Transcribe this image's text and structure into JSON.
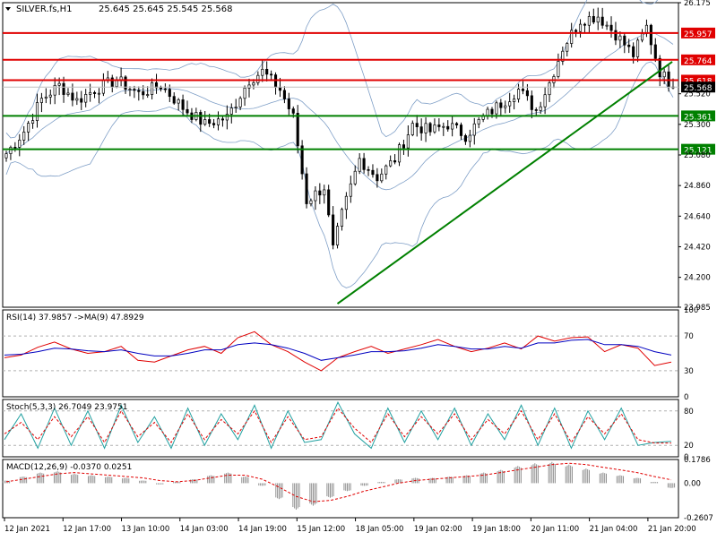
{
  "header": {
    "symbol": "SILVER.fs,H1",
    "ohlc": "25.645 25.645 25.545 25.568"
  },
  "colors": {
    "background": "#ffffff",
    "resistance": "#e00000",
    "support": "#008000",
    "trendline": "#008000",
    "candle": "#000000",
    "bollinger": "#7f9fc7",
    "rsi": "#e00000",
    "rsi_ma": "#0000c0",
    "stoch_main": "#20a0a0",
    "stoch_signal": "#e00000",
    "macd_hist": "#909090",
    "macd_signal": "#e00000",
    "grid_level": "#b0b0b0"
  },
  "chart_data": [
    {
      "type": "candlestick",
      "panel": "price",
      "ylim": [
        23.985,
        26.175
      ],
      "y_ticks": [
        "26.175",
        "25.957",
        "25.764",
        "25.618",
        "25.568",
        "25.520",
        "25.361",
        "25.300",
        "25.121",
        "25.080",
        "24.860",
        "24.640",
        "24.420",
        "24.200",
        "23.985"
      ],
      "x_labels": [
        "12 Jan 2021",
        "12 Jan 17:00",
        "13 Jan 10:00",
        "14 Jan 03:00",
        "14 Jan 19:00",
        "15 Jan 12:00",
        "18 Jan 05:00",
        "19 Jan 02:00",
        "19 Jan 18:00",
        "20 Jan 11:00",
        "21 Jan 04:00",
        "21 Jan 20:00"
      ],
      "levels": [
        {
          "value": 25.957,
          "label": "25.957",
          "kind": "resistance"
        },
        {
          "value": 25.764,
          "label": "25.764",
          "kind": "resistance"
        },
        {
          "value": 25.618,
          "label": "25.618",
          "kind": "resistance"
        },
        {
          "value": 25.361,
          "label": "25.361",
          "kind": "support"
        },
        {
          "value": 25.121,
          "label": "25.121",
          "kind": "support"
        }
      ],
      "current_price": {
        "value": 25.568,
        "label": "25.568"
      },
      "trendline": {
        "from": {
          "bar": 75,
          "value": 24.01
        },
        "to": {
          "bar": 150,
          "value": 25.75
        }
      },
      "close_path": [
        {
          "bar": 0,
          "value": 25.09
        },
        {
          "bar": 4,
          "value": 25.25
        },
        {
          "bar": 8,
          "value": 25.48
        },
        {
          "bar": 12,
          "value": 25.58
        },
        {
          "bar": 16,
          "value": 25.47
        },
        {
          "bar": 20,
          "value": 25.55
        },
        {
          "bar": 25,
          "value": 25.62
        },
        {
          "bar": 30,
          "value": 25.52
        },
        {
          "bar": 35,
          "value": 25.58
        },
        {
          "bar": 40,
          "value": 25.42
        },
        {
          "bar": 45,
          "value": 25.3
        },
        {
          "bar": 50,
          "value": 25.35
        },
        {
          "bar": 55,
          "value": 25.62
        },
        {
          "bar": 58,
          "value": 25.68
        },
        {
          "bar": 62,
          "value": 25.55
        },
        {
          "bar": 65,
          "value": 25.35
        },
        {
          "bar": 68,
          "value": 24.75
        },
        {
          "bar": 72,
          "value": 24.85
        },
        {
          "bar": 74,
          "value": 24.4
        },
        {
          "bar": 76,
          "value": 24.65
        },
        {
          "bar": 80,
          "value": 25.05
        },
        {
          "bar": 84,
          "value": 24.92
        },
        {
          "bar": 88,
          "value": 25.05
        },
        {
          "bar": 92,
          "value": 25.3
        },
        {
          "bar": 96,
          "value": 25.25
        },
        {
          "bar": 100,
          "value": 25.3
        },
        {
          "bar": 104,
          "value": 25.22
        },
        {
          "bar": 108,
          "value": 25.35
        },
        {
          "bar": 112,
          "value": 25.45
        },
        {
          "bar": 116,
          "value": 25.55
        },
        {
          "bar": 120,
          "value": 25.4
        },
        {
          "bar": 123,
          "value": 25.6
        },
        {
          "bar": 126,
          "value": 25.85
        },
        {
          "bar": 130,
          "value": 26.05
        },
        {
          "bar": 134,
          "value": 26.08
        },
        {
          "bar": 138,
          "value": 25.95
        },
        {
          "bar": 142,
          "value": 25.8
        },
        {
          "bar": 145,
          "value": 26.0
        },
        {
          "bar": 148,
          "value": 25.68
        },
        {
          "bar": 151,
          "value": 25.57
        }
      ]
    },
    {
      "type": "line",
      "panel": "rsi",
      "title": "RSI(14) 37.9857 ->MA(9) 47.8929",
      "ylim": [
        0,
        100
      ],
      "y_ticks": [
        "100",
        "70",
        "30",
        "0"
      ],
      "levels": [
        70,
        30
      ],
      "series": [
        {
          "values": [
            45,
            48,
            57,
            63,
            55,
            50,
            52,
            58,
            42,
            40,
            47,
            54,
            58,
            50,
            68,
            75,
            60,
            52,
            40,
            30,
            45,
            52,
            58,
            50,
            55,
            60,
            66,
            58,
            52,
            56,
            62,
            55,
            70,
            64,
            68,
            69,
            52,
            60,
            56,
            36,
            40
          ]
        },
        {
          "values": [
            48,
            49,
            52,
            56,
            55,
            53,
            52,
            54,
            50,
            47,
            47,
            50,
            54,
            54,
            60,
            62,
            60,
            56,
            50,
            42,
            45,
            48,
            52,
            52,
            53,
            56,
            60,
            58,
            55,
            55,
            58,
            56,
            62,
            62,
            65,
            66,
            60,
            60,
            58,
            52,
            48
          ]
        }
      ]
    },
    {
      "type": "line",
      "panel": "stochastic",
      "title": "Stoch(5,3,3) 26.7049 23.9751",
      "ylim": [
        0,
        100
      ],
      "y_ticks": [
        "80",
        "20",
        "0"
      ],
      "levels": [
        80,
        20
      ],
      "series": [
        {
          "values": [
            30,
            75,
            15,
            85,
            20,
            80,
            15,
            90,
            25,
            70,
            15,
            85,
            20,
            75,
            30,
            90,
            15,
            80,
            25,
            30,
            95,
            40,
            15,
            85,
            25,
            80,
            30,
            85,
            20,
            75,
            30,
            90,
            20,
            85,
            15,
            80,
            30,
            85,
            20,
            25,
            27
          ]
        },
        {
          "values": [
            40,
            60,
            30,
            70,
            35,
            70,
            25,
            80,
            35,
            60,
            25,
            75,
            30,
            65,
            40,
            80,
            25,
            70,
            30,
            35,
            85,
            50,
            25,
            75,
            35,
            70,
            40,
            75,
            30,
            65,
            40,
            80,
            30,
            75,
            25,
            70,
            40,
            75,
            30,
            24,
            24
          ]
        }
      ]
    },
    {
      "type": "bar",
      "panel": "macd",
      "title": "MACD(12,26,9) -0.0370 0.0251",
      "ylim": [
        -0.2607,
        0.1786
      ],
      "y_ticks": [
        "0.1786",
        "0.00",
        "-0.2607"
      ],
      "series": [
        {
          "values": [
            0.02,
            0.05,
            0.08,
            0.09,
            0.07,
            0.06,
            0.05,
            0.04,
            0.02,
            -0.01,
            0.01,
            0.03,
            0.06,
            0.08,
            0.05,
            -0.02,
            -0.12,
            -0.2,
            -0.17,
            -0.11,
            -0.06,
            -0.02,
            0.01,
            0.03,
            0.04,
            0.04,
            0.05,
            0.06,
            0.08,
            0.1,
            0.13,
            0.15,
            0.16,
            0.14,
            0.11,
            0.08,
            0.06,
            0.04,
            0.01,
            -0.037
          ]
        },
        {
          "values": [
            0.01,
            0.03,
            0.05,
            0.07,
            0.08,
            0.07,
            0.06,
            0.05,
            0.04,
            0.02,
            0.01,
            0.02,
            0.04,
            0.06,
            0.06,
            0.03,
            -0.03,
            -0.1,
            -0.14,
            -0.13,
            -0.1,
            -0.06,
            -0.03,
            0.0,
            0.02,
            0.03,
            0.04,
            0.05,
            0.06,
            0.08,
            0.1,
            0.12,
            0.14,
            0.15,
            0.14,
            0.12,
            0.1,
            0.08,
            0.05,
            0.025
          ]
        }
      ]
    }
  ]
}
